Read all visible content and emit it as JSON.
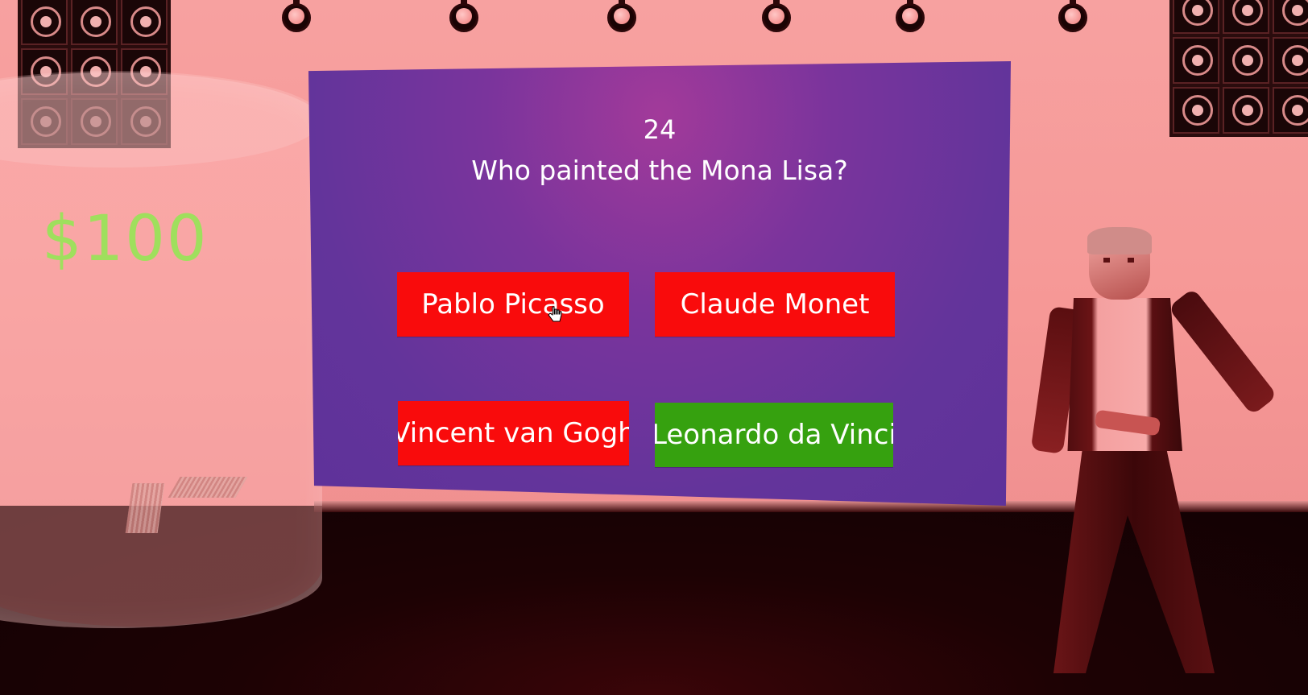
{
  "game": {
    "prize": "$100",
    "question_number": "24",
    "question": "Who painted the Mona Lisa?",
    "answers": [
      {
        "label": "Pablo Picasso",
        "state": "red"
      },
      {
        "label": "Claude Monet",
        "state": "red"
      },
      {
        "label": "Vincent van Gogh",
        "state": "red"
      },
      {
        "label": "Leonardo da Vinci",
        "state": "green"
      }
    ]
  },
  "colors": {
    "wall": "#f69896",
    "board": "#6a349b",
    "answer_wrong": "#f90b0c",
    "answer_correct": "#36a10f",
    "prize_text": "#9be35a"
  },
  "icons": {
    "cursor": "hand-pointer-icon"
  }
}
